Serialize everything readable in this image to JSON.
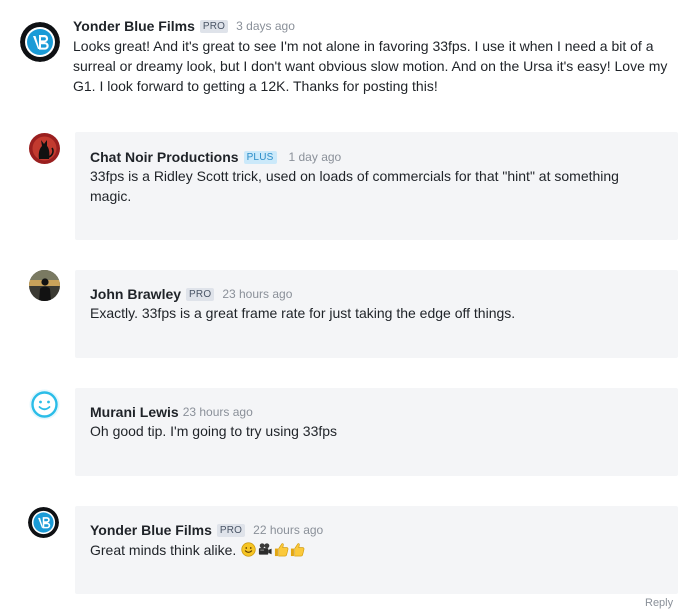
{
  "comments": [
    {
      "author": "Yonder Blue Films",
      "badge": "PRO",
      "time": "3 days ago",
      "text": "Looks great! And it's great to see I'm not alone in favoring 33fps. I use it when I need a bit of a surreal or dreamy look, but I don't want obvious slow motion. And on the Ursa it's easy! Love my G1. I look forward to getting a 12K. Thanks for posting this!",
      "avatar_icon": "yonder-blue-logo-icon"
    },
    {
      "author": "Chat Noir Productions",
      "badge": "PLUS",
      "time": "1 day ago",
      "text": "33fps is a Ridley Scott trick, used on loads of commercials for that \"hint\" at something magic.",
      "avatar_icon": "black-cat-avatar-icon"
    },
    {
      "author": "John Brawley",
      "badge": "PRO",
      "time": "23 hours ago",
      "text": "Exactly. 33fps is a great frame rate for just taking the edge off things.",
      "avatar_icon": "person-silhouette-avatar-icon"
    },
    {
      "author": "Murani Lewis",
      "badge": "",
      "time": "23 hours ago",
      "text": "Oh good tip. I'm going to try using 33fps",
      "avatar_icon": "default-smiley-avatar-icon"
    },
    {
      "author": "Yonder Blue Films",
      "badge": "PRO",
      "time": "22 hours ago",
      "text": "Great minds think alike.",
      "avatar_icon": "yonder-blue-logo-icon",
      "emojis": [
        "smiling-face-icon",
        "movie-camera-icon",
        "thumbs-up-icon",
        "thumbs-up-icon"
      ]
    }
  ],
  "footer": {
    "reply_label": "Reply"
  },
  "colors": {
    "brand_blue": "#1a9bd7",
    "reply_bg": "#f4f5f7",
    "badge_pro_bg": "#dfe3ea",
    "badge_plus_bg": "#cbe9fa",
    "muted_text": "#8a9099"
  }
}
